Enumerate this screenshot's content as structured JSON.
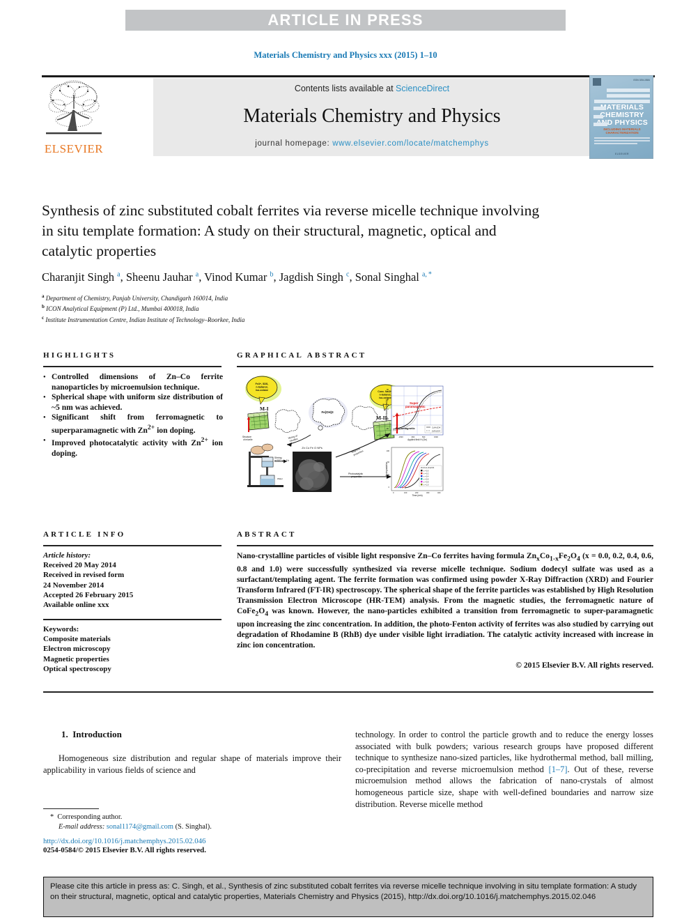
{
  "banner": {
    "text": "ARTICLE IN PRESS"
  },
  "running_head": "Materials Chemistry and Physics xxx (2015) 1–10",
  "masthead": {
    "contents_prefix": "Contents lists available at ",
    "sciencedirect": "ScienceDirect",
    "journal_name": "Materials Chemistry and Physics",
    "homepage_prefix": "journal homepage: ",
    "homepage_url": "www.elsevier.com/locate/matchemphys",
    "publisher": "ELSEVIER",
    "cover": {
      "title": "MATERIALS CHEMISTRY AND PHYSICS",
      "subtitle": "INCLUDING MATERIALS CHARACTERIZATION",
      "issn": "ISSN 0254-0584",
      "footer": "ELSEVIER"
    }
  },
  "article": {
    "title": "Synthesis of zinc substituted cobalt ferrites via reverse micelle technique involving in situ template formation: A study on their structural, magnetic, optical and catalytic properties",
    "authors_html": "Charanjit Singh <sup>a</sup>, Sheenu Jauhar <sup>a</sup>, Vinod Kumar <sup>b</sup>, Jagdish Singh <sup>c</sup>, Sonal Singhal <sup>a, *</sup>",
    "affiliations": [
      {
        "marker": "a",
        "text": "Department of Chemistry, Panjab University, Chandigarh 160014, India"
      },
      {
        "marker": "b",
        "text": "ICON Analytical Equipment (P) Ltd., Mumbai 400018, India"
      },
      {
        "marker": "c",
        "text": "Institute Instrumentation Centre, Indian Institute of Technology–Roorkee, India"
      }
    ]
  },
  "highlights": {
    "heading": "HIGHLIGHTS",
    "items": [
      "Controlled dimensions of Zn–Co ferrite nanoparticles by microemulsion technique.",
      "Spherical shape with uniform size distribution of ~5 nm was achieved.",
      "Significant shift from ferromagnetic to superparamagnetic with Zn2+ ion doping.",
      "Improved photocatalytic activity with Zn2+ ion doping."
    ]
  },
  "graphical_abstract": {
    "heading": "GRAPHICAL ABSTRACT",
    "labels": {
      "micelle_1": "M-I",
      "micelle_2": "M-II",
      "bubble_1": "Fe3+ , SDS, n-butanol, iso-octane",
      "bubble_2": "Conc. NaOH, n-butanol, iso-octane",
      "intermediate": "Fe(OH)3",
      "product": "ZnₓCo₁₋ₓFe₂O₄ NPs",
      "arrow_mixing": "Mixing of micelles",
      "arrow_stirring": "Stirring at 600 rpm 5 h",
      "arrow_field": "Field emission",
      "arrow_magnetic": "Magnetic properties",
      "arrow_photo": "Photocatalytic properties",
      "plot1_super": "Super paramagnetic",
      "plot1_ferro": "Ferromagnetic",
      "plot1_xlabel": "Applied field H (Oe)",
      "plot1_ylabel": "Magnetization (emu/g)",
      "plot2_xlabel": "Time (min)",
      "plot2_ylabel": "% degradation",
      "plot2_legend_title": "ZnₓCo₁₋ₓFe₂O₄",
      "plot2_legend": [
        "x = 0.0",
        "x = 0.2",
        "x = 0.4",
        "x = 0.6",
        "x = 0.8",
        "x = 1.0"
      ]
    }
  },
  "article_info": {
    "heading": "ARTICLE INFO",
    "history_label": "Article history:",
    "history": [
      "Received 20 May 2014",
      "Received in revised form",
      "24 November 2014",
      "Accepted 26 February 2015",
      "Available online xxx"
    ],
    "keywords_label": "Keywords:",
    "keywords": [
      "Composite materials",
      "Electron microscopy",
      "Magnetic properties",
      "Optical spectroscopy"
    ]
  },
  "abstract": {
    "heading": "ABSTRACT",
    "text_html": "Nano-crystalline particles of visible light responsive Zn–Co ferrites having formula Zn<sub>x</sub>Co<sub>1-x</sub>Fe<sub>2</sub>O<sub>4</sub> (x&nbsp;=&nbsp;0.0, 0.2, 0.4, 0.6, 0.8 and 1.0) were successfully synthesized via reverse micelle technique. Sodium dodecyl sulfate was used as a surfactant/templating agent. The ferrite formation was confirmed using powder X-Ray Diffraction (XRD) and Fourier Transform Infrared (FT-IR) spectroscopy. The spherical shape of the ferrite particles was established by High Resolution Transmission Electron Microscope (HR-TEM) analysis. From the magnetic studies, the ferromagnetic nature of CoFe<sub>2</sub>O<sub>4</sub> was known. However, the nano-particles exhibited a transition from ferromagnetic to super-paramagnetic upon increasing the zinc concentration. In addition, the photo-Fenton activity of ferrites was also studied by carrying out degradation of Rhodamine B (RhB) dye under visible light irradiation. The catalytic activity increased with increase in zinc ion concentration.",
    "copyright": "© 2015 Elsevier B.V. All rights reserved."
  },
  "body": {
    "section_number": "1.",
    "section_title": "Introduction",
    "left_column": "Homogeneous size distribution and regular shape of materials improve their applicability in various fields of science and",
    "right_column_html": "technology. In order to control the particle growth and to reduce the energy losses associated with bulk powders; various research groups have proposed different technique to synthesize nano-sized particles, like hydrothermal method, ball milling, co-precipitation and reverse microemulsion method <a href=\"#\">[1–7]</a>. Out of these, reverse microemulsion method allows the fabrication of nano-crystals of almost homogeneous particle size, shape with well-defined boundaries and narrow size distribution. Reverse micelle method"
  },
  "footer": {
    "corresponding_marker": "*",
    "corresponding_label": "Corresponding author.",
    "email_label": "E-mail address:",
    "email": "sonal1174@gmail.com",
    "email_suffix": "(S. Singhal).",
    "doi": "http://dx.doi.org/10.1016/j.matchemphys.2015.02.046",
    "issn_copyright": "0254-0584/© 2015 Elsevier B.V. All rights reserved."
  },
  "cite_box": {
    "text": "Please cite this article in press as: C. Singh, et al., Synthesis of zinc substituted cobalt ferrites via reverse micelle technique involving in situ template formation: A study on their structural, magnetic, optical and catalytic properties, Materials Chemistry and Physics (2015), http://dx.doi.org/10.1016/j.matchemphys.2015.02.046"
  },
  "colors": {
    "link_blue": "#1a7ab5",
    "sciencedirect_blue": "#2a8fc4",
    "elsevier_orange": "#E87722",
    "banner_gray": "#c2c4c6",
    "panel_gray": "#e9e9e9"
  }
}
